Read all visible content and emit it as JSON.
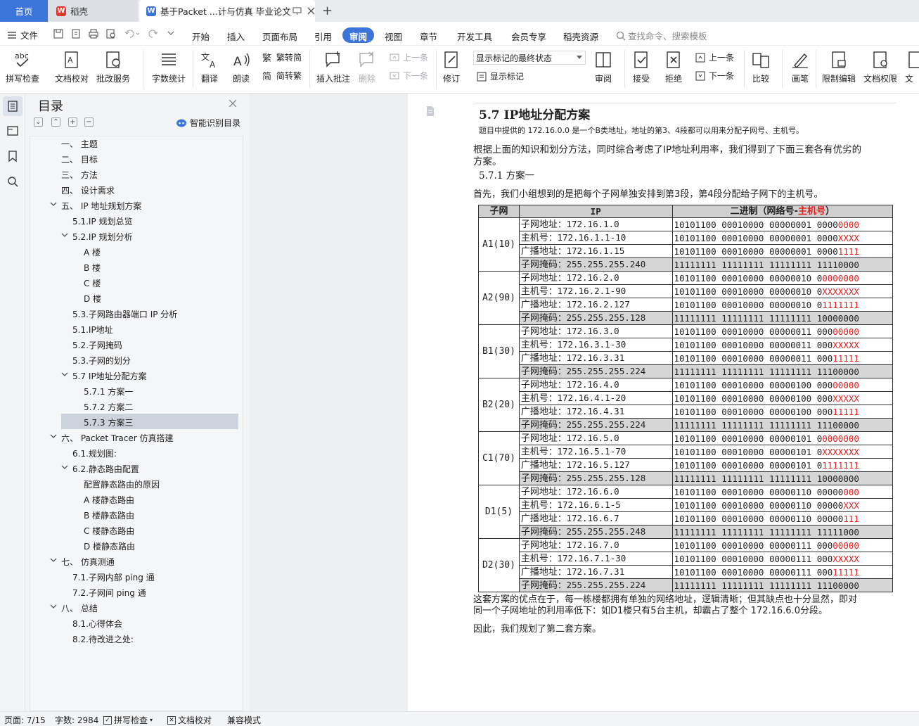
{
  "tabs": {
    "home": "首页",
    "wps": "稻壳",
    "doc": "基于Packet ...计与仿真 毕业论文",
    "plus": "+"
  },
  "menu": {
    "file": "文件",
    "items": [
      "开始",
      "插入",
      "页面布局",
      "引用",
      "审阅",
      "视图",
      "章节",
      "开发工具",
      "会员专享",
      "稻壳资源"
    ],
    "active": "审阅",
    "search_placeholder": "查找命令、搜索模板"
  },
  "ribbon": {
    "spell_check": "拼写检查",
    "doc_proof": "文档校对",
    "annotate_service": "批改服务",
    "word_count": "字数统计",
    "translate": "翻译",
    "read_aloud": "朗读",
    "to_traditional": "繁转简",
    "to_simplified": "简转繁",
    "insert_comment": "插入批注",
    "delete": "删除",
    "prev": "上一条",
    "next": "下一条",
    "revise": "修订",
    "display_state": "显示标记的最终状态",
    "show_marks": "显示标记",
    "review": "审阅",
    "accept": "接受",
    "reject": "拒绝",
    "prev2": "上一条",
    "next2": "下一条",
    "compare": "比较",
    "pen": "画笔",
    "restrict_edit": "限制编辑",
    "doc_permission": "文档权限",
    "doc_cut": "文"
  },
  "toc": {
    "title": "目录",
    "smart": "智能识别目录",
    "items": [
      {
        "label": "一、  主题",
        "level": 0
      },
      {
        "label": "二、  目标",
        "level": 0
      },
      {
        "label": "三、  方法",
        "level": 0
      },
      {
        "label": "四、  设计需求",
        "level": 0
      },
      {
        "label": "五、  IP 地址规划方案",
        "level": 0,
        "expanded": true
      },
      {
        "label": "5.1.IP 规划总览",
        "level": 1
      },
      {
        "label": "5.2.IP 规划分析",
        "level": 1,
        "expanded": true
      },
      {
        "label": "A 楼",
        "level": 2
      },
      {
        "label": "B 楼",
        "level": 2
      },
      {
        "label": "C 楼",
        "level": 2
      },
      {
        "label": "D 楼",
        "level": 2
      },
      {
        "label": "5.3.子网路由器端口 IP 分析",
        "level": 1
      },
      {
        "label": "5.1.IP地址",
        "level": 1
      },
      {
        "label": "5.2.子网掩码",
        "level": 1
      },
      {
        "label": "5.3.子网的划分",
        "level": 1
      },
      {
        "label": "5.7 IP地址分配方案",
        "level": 1,
        "expanded": true,
        "selected": true
      },
      {
        "label": "5.7.1 方案一",
        "level": 2
      },
      {
        "label": "5.7.2 方案二",
        "level": 2
      },
      {
        "label": "5.7.3 方案三",
        "level": 2
      },
      {
        "label": "六、  Packet Tracer 仿真搭建",
        "level": 0,
        "expanded": true
      },
      {
        "label": "6.1.规划图:",
        "level": 1
      },
      {
        "label": "6.2.静态路由配置",
        "level": 1,
        "expanded": true
      },
      {
        "label": "配置静态路由的原因",
        "level": 2
      },
      {
        "label": "A 楼静态路由",
        "level": 2
      },
      {
        "label": "B 楼静态路由",
        "level": 2
      },
      {
        "label": "C 楼静态路由",
        "level": 2
      },
      {
        "label": "D 楼静态路由",
        "level": 2
      },
      {
        "label": "七、  仿真测通",
        "level": 0,
        "expanded": true
      },
      {
        "label": "7.1.子网内部 ping 通",
        "level": 1
      },
      {
        "label": "7.2.子网间 ping 通",
        "level": 1
      },
      {
        "label": "八、  总结",
        "level": 0,
        "expanded": true
      },
      {
        "label": "8.1.心得体会",
        "level": 1
      },
      {
        "label": "8.2.待改进之处:",
        "level": 1
      }
    ]
  },
  "doc": {
    "heading": "5.7 IP地址分配方案",
    "intro": "题目中提供的 172.16.0.0 是一个B类地址，地址的第3、4段都可以用来分配子网号、主机号。",
    "para1_line1": "根据上面的知识和划分方法，同时综合考虑了IP地址利用率，我们得到了下面三套各有优劣的",
    "para1_line2": "方案。",
    "sub_heading": "5.7.1 方案一",
    "para2": "首先，我们小组想到的是把每个子网单独安排到第3段，第4段分配给子网下的主机号。",
    "table_head": {
      "subnet": "子网",
      "ip": "IP",
      "binary_prefix": "二进制（网络号-",
      "binary_host": "主机号",
      "binary_suffix": "）"
    },
    "table": [
      {
        "name": "A1(10)",
        "rows": [
          [
            "子网地址",
            "：172.16.1.0",
            "10101100 00010000 00000001 0000",
            "0000"
          ],
          [
            "主机号",
            "：172.16.1.1-10",
            "10101100 00010000 00000001 0000",
            "XXXX"
          ],
          [
            "广播地址",
            "：172.16.1.15",
            "10101100 00010000 00000001 0000",
            "1111"
          ],
          [
            "子网掩码",
            "：255.255.255.240",
            "11111111 11111111 11111111 11110000",
            ""
          ]
        ]
      },
      {
        "name": "A2(90)",
        "rows": [
          [
            "子网地址",
            "：172.16.2.0",
            "10101100 00010000 00000010 0",
            "0000000"
          ],
          [
            "主机号",
            "：172.16.2.1-90",
            "10101100 00010000 00000010 0",
            "XXXXXXX"
          ],
          [
            "广播地址",
            "：172.16.2.127",
            "10101100 00010000 00000010 0",
            "1111111"
          ],
          [
            "子网掩码",
            "：255.255.255.128",
            "11111111 11111111 11111111 10000000",
            ""
          ]
        ]
      },
      {
        "name": "B1(30)",
        "rows": [
          [
            "子网地址",
            "：172.16.3.0",
            "10101100 00010000 00000011 000",
            "00000"
          ],
          [
            "主机号",
            "：172.16.3.1-30",
            "10101100 00010000 00000011 000",
            "XXXXX"
          ],
          [
            "广播地址",
            "：172.16.3.31",
            "10101100 00010000 00000011 000",
            "11111"
          ],
          [
            "子网掩码",
            "：255.255.255.224",
            "11111111 11111111 11111111 11100000",
            ""
          ]
        ]
      },
      {
        "name": "B2(20)",
        "rows": [
          [
            "子网地址",
            "：172.16.4.0",
            "10101100 00010000 00000100 000",
            "00000"
          ],
          [
            "主机号",
            "：172.16.4.1-20",
            "10101100 00010000 00000100 000",
            "XXXXX"
          ],
          [
            "广播地址",
            "：172.16.4.31",
            "10101100 00010000 00000100 000",
            "11111"
          ],
          [
            "子网掩码",
            "：255.255.255.224",
            "11111111 11111111 11111111 11100000",
            ""
          ]
        ]
      },
      {
        "name": "C1(70)",
        "rows": [
          [
            "子网地址",
            "：172.16.5.0",
            "10101100 00010000 00000101 0",
            "0000000"
          ],
          [
            "主机号",
            "：172.16.5.1-70",
            "10101100 00010000 00000101 0",
            "XXXXXXX"
          ],
          [
            "广播地址",
            "：172.16.5.127",
            "10101100 00010000 00000101 0",
            "1111111"
          ],
          [
            "子网掩码",
            "：255.255.255.128",
            "11111111 11111111 11111111 10000000",
            ""
          ]
        ]
      },
      {
        "name": "D1(5)",
        "rows": [
          [
            "子网地址",
            "：172.16.6.0",
            "10101100 00010000 00000110 00000",
            "000"
          ],
          [
            "主机号",
            "：172.16.6.1-5",
            "10101100 00010000 00000110 00000",
            "XXX"
          ],
          [
            "广播地址",
            "：172.16.6.7",
            "10101100 00010000 00000110 00000",
            "111"
          ],
          [
            "子网掩码",
            "：255.255.255.248",
            "11111111 11111111 11111111 11111000",
            ""
          ]
        ]
      },
      {
        "name": "D2(30)",
        "rows": [
          [
            "子网地址",
            "：172.16.7.0",
            "10101100 00010000 00000111 000",
            "00000"
          ],
          [
            "主机号",
            "：172.16.7.1-30",
            "10101100 00010000 00000111 000",
            "XXXXX"
          ],
          [
            "广播地址",
            "：172.16.7.31",
            "10101100 00010000 00000111 000",
            "11111"
          ],
          [
            "子网掩码",
            "：255.255.255.224",
            "11111111 11111111 11111111 11100000",
            ""
          ]
        ]
      }
    ],
    "para3_line1": "这套方案的优点在于，每一栋楼都拥有单独的网络地址，逻辑清晰；但其缺点也十分显然，即对",
    "para3_line2": "同一个子网地址的利用率低下：如D1楼只有5台主机，却霸占了整个 172.16.6.0分段。",
    "para4": "因此，我们规划了第二套方案。"
  },
  "status": {
    "page": "页面: 7/15",
    "words": "字数: 2984",
    "spell": "拼写检查",
    "proof": "文档校对",
    "compat": "兼容模式"
  },
  "colors": {
    "accent": "#3b75d9",
    "red": "#e21f1f",
    "wps_red": "#e03a2f"
  }
}
